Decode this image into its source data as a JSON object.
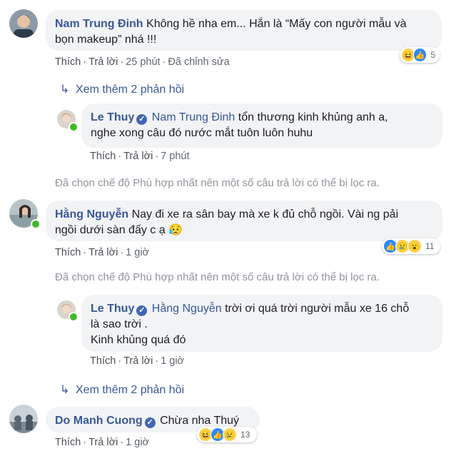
{
  "comments": [
    {
      "name": "Nam Trung Đinh",
      "text_line1": "Không hề nha em... Hắn là “Mấy con người mẫu và",
      "text_line2": "bọn makeup” nhá !!!",
      "like": "Thích",
      "reply": "Trả lời",
      "time": "25 phút",
      "edited": "Đã chỉnh sửa",
      "reaction_count": "5",
      "reactions": [
        "haha-icon",
        "like-icon"
      ]
    },
    {
      "name": "Hằng Nguyễn",
      "text_line1": "Nay đi xe ra sân bay mà xe k đủ chỗ ngồi. Vài ng pải",
      "text_line2": "ngồi dưới sàn đấy c ạ 😥",
      "like": "Thích",
      "reply": "Trả lời",
      "time": "1 giờ",
      "reaction_count": "11",
      "reactions": [
        "like-icon",
        "sad-icon",
        "wow-icon"
      ]
    },
    {
      "name": "Do Manh Cuong",
      "text_line1": "Chừa nha Thuý",
      "like": "Thích",
      "reply": "Trả lời",
      "time": "1 giờ",
      "reaction_count": "13",
      "reactions": [
        "haha-icon",
        "like-icon",
        "sad-icon"
      ]
    }
  ],
  "replies": [
    {
      "name": "Le Thuy",
      "tag": "Nam Trung Đinh",
      "text_line1": "tổn thương kinh khủng anh a,",
      "text_line2": "nghe xong câu đó nước mắt tuôn luôn huhu",
      "like": "Thích",
      "reply": "Trả lời",
      "time": "7 phút"
    },
    {
      "name": "Le Thuy",
      "tag": "Hằng Nguyễn",
      "text_line1": "trời ơi quá trời người mẫu xe 16 chỗ",
      "text_line2": "là sao trời .",
      "text_line3": "Kinh khủng quá đó",
      "like": "Thích",
      "reply": "Trả lời",
      "time": "1 giờ"
    }
  ],
  "see_more_1": "Xem thêm 2 phản hồi",
  "see_more_2": "Xem thêm 2 phản hồi",
  "filtered_1": "Đã chọn chế độ Phù hợp nhất nên một số câu trả lời có thể bị lọc ra.",
  "filtered_2": "Đã chọn chế độ Phù hợp nhất nên một số câu trả lời có thể bị lọc ra.",
  "colors": {
    "name": "#385898",
    "bubble": "#f2f3f5",
    "meta": "#606770",
    "online": "#42b72a"
  }
}
